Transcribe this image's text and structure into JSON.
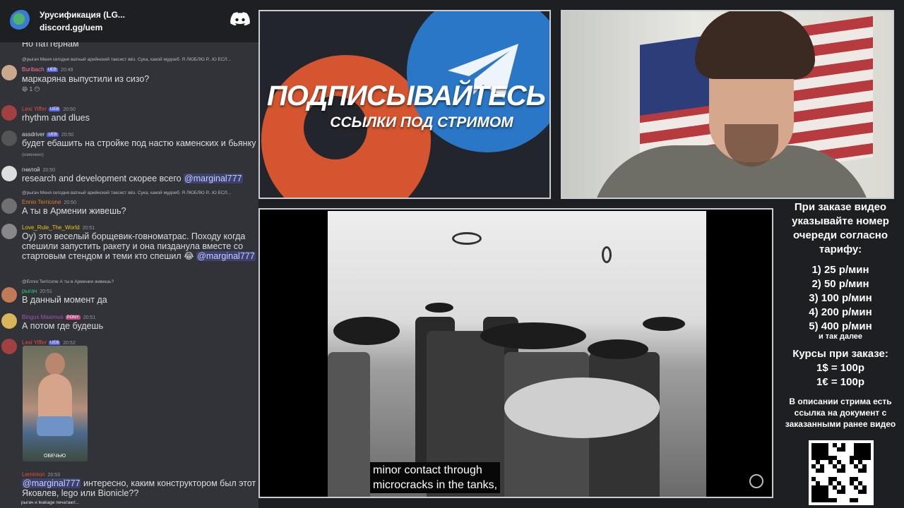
{
  "server": {
    "name": "Урусификация (LG...",
    "invite": "discord.gg/uem"
  },
  "messages": [
    {
      "id": "m0",
      "text": "Но паттернам"
    },
    {
      "id": "m1",
      "reply": "@рыгач Меня сегодня ватный арийнский таксист вёз. Сука, какой мудоеб. Я ЛЮБЛЮ Р...Ю ЕСЛ...",
      "user": "Buribach",
      "user_color": "#ff73a3",
      "badge": "UEB",
      "time": "20:49",
      "text": "маркаряна выпустили из сизо?",
      "reaction": "😆 1  😶"
    },
    {
      "id": "m2",
      "user": "Lexi Yiffer",
      "user_color": "#e74c3c",
      "badge": "UEB",
      "time": "20:50",
      "text": "rhythm and dlues"
    },
    {
      "id": "m3",
      "user": "assdriver",
      "user_color": "#dbdee1",
      "badge": "UEB",
      "time": "20:50",
      "text": "будет ебашить на стройке под настю каменских и бьянку",
      "tag": "(изменено)"
    },
    {
      "id": "m4",
      "user": "гнилой",
      "user_color": "#dbdee1",
      "time": "20:50",
      "text": "research and development скорее всего",
      "mention": "@marginal777"
    },
    {
      "id": "m5",
      "reply": "@рыгач Меня сегодня ватный арийнский таксист вёз. Сука, какой мудоеб. Я ЛЮБЛЮ Р...Ю ЕСЛ...",
      "user": "Ennio Terricone",
      "user_color": "#e67e22",
      "time": "20:50",
      "text": "А ты в Армении живешь?"
    },
    {
      "id": "m6",
      "user": "Love_Rule_The_World",
      "user_color": "#f1c40f",
      "time": "20:51",
      "text": "Оу) это веселый борщевик-говноматрас. Походу когда спешили запустить ракету и она пизданула вместе со стартовым стендом и теми кто спешил 😂",
      "mention": "@marginal777"
    },
    {
      "id": "m7",
      "reply": "@Ennio Terricone А ты в Армении живешь?",
      "user": "рыгач",
      "user_color": "#2ecc71",
      "time": "20:51",
      "text": "В данный момент да"
    },
    {
      "id": "m8",
      "user": "Bingus Maximus",
      "user_color": "#9b59b6",
      "badge": "PONY",
      "time": "20:51",
      "text": "А потом где будешь"
    },
    {
      "id": "m9",
      "user": "Lexi Yiffer",
      "user_color": "#e74c3c",
      "badge": "UEB",
      "time": "20:52",
      "image_caption": "ОБЕЧЬЮ"
    },
    {
      "id": "m10",
      "user": "Leminion",
      "user_color": "#e74c3c",
      "time": "20:53",
      "mention": "@marginal777",
      "text": "интересно, каким конструктором был этот Яковлев, lego или Bionicle??"
    }
  ],
  "typing": "рыгач и leakage печатают...",
  "promo": {
    "title": "ПОДПИСЫВАЙТЕСЬ",
    "subtitle": "ССЫЛКИ ПОД СТРИМОМ"
  },
  "video": {
    "subtitle_line1": "minor contact through",
    "subtitle_line2": "microcracks in the tanks,"
  },
  "info": {
    "heading": "При заказе видео указывайте номер очереди согласно тарифу:",
    "tariffs": [
      "1) 25 р/мин",
      "2) 50 р/мин",
      "3) 100 р/мин",
      "4) 200 р/мин",
      "5) 400 р/мин"
    ],
    "tariffs_more": "и так далее",
    "rates_title": "Курсы при заказе:",
    "rates": [
      "1$ = 100р",
      "1€ = 100р"
    ],
    "description": "В описании стрима есть ссылка на документ с заказанными ранее видео"
  },
  "colors": {
    "discord_bg": "#313338",
    "header_bg": "#1e1f22",
    "mention": "#c9cdfb",
    "telegram_blue": "#2a77c7",
    "boosty_orange": "#d4552f"
  }
}
